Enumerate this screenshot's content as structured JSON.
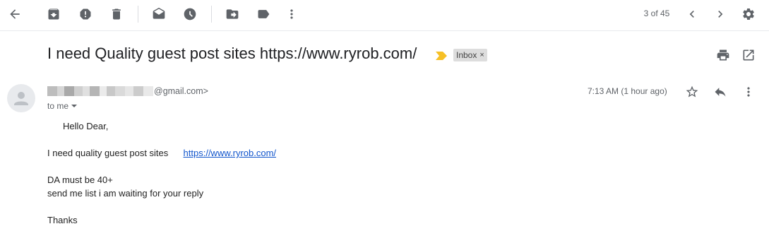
{
  "toolbar": {
    "icons": [
      "back-arrow-icon",
      "archive-icon",
      "report-spam-icon",
      "delete-icon",
      "mark-unread-icon",
      "snooze-icon",
      "move-to-icon",
      "labels-icon",
      "more-vert-icon"
    ],
    "pager": "3 of 45"
  },
  "email": {
    "subject": "I need Quality guest post sites https://www.ryrob.com/",
    "label": "Inbox",
    "label_remove": "×",
    "sender_email_domain": "@gmail.com>",
    "to": "to me",
    "time": "7:13 AM (1 hour ago)",
    "body": {
      "greeting": "Hello Dear,",
      "line1_text": "I need quality guest post sites",
      "line1_link": "https://www.ryrob.com/",
      "line2": "DA must be 40+",
      "line3": "send me list i am waiting for your reply",
      "closing": "Thanks"
    }
  },
  "colors": {
    "icon_gray": "#5f6368",
    "link_blue": "#1155cc",
    "importance_yellow": "#f6c026",
    "chip_gray": "#dddddd"
  }
}
